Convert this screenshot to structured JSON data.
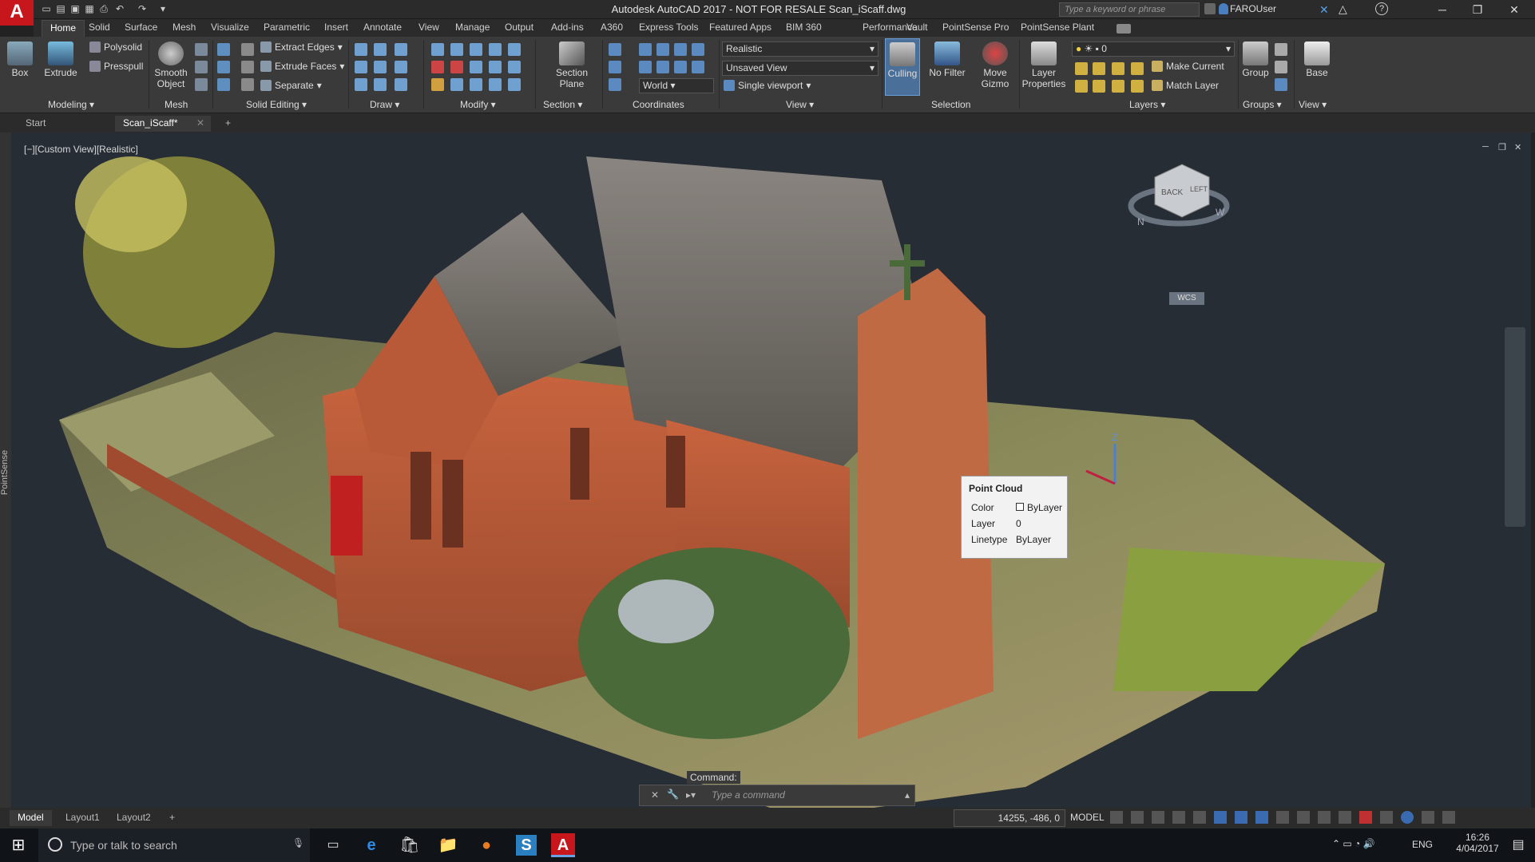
{
  "app": {
    "logo": "A",
    "title": "Autodesk AutoCAD 2017 - NOT FOR RESALE    Scan_iScaff.dwg",
    "search_placeholder": "Type a keyword or phrase",
    "user": "FAROUser"
  },
  "menu_tabs": [
    "Home",
    "Solid",
    "Surface",
    "Mesh",
    "Visualize",
    "Parametric",
    "Insert",
    "Annotate",
    "View",
    "Manage",
    "Output",
    "Add-ins",
    "A360",
    "Express Tools",
    "Featured Apps",
    "BIM 360",
    "Performance",
    "Vault",
    "PointSense Pro",
    "PointSense Plant"
  ],
  "ribbon": {
    "box": "Box",
    "extrude": "Extrude",
    "polysolid": "Polysolid",
    "presspull": "Presspull",
    "smooth_object_1": "Smooth",
    "smooth_object_2": "Object",
    "extract_edges": "Extract Edges",
    "extrude_faces": "Extrude Faces",
    "separate": "Separate",
    "section_plane_1": "Section",
    "section_plane_2": "Plane",
    "visual_style": "Realistic",
    "named_view": "Unsaved View",
    "ucs": "World",
    "viewport_config": "Single viewport",
    "culling": "Culling",
    "no_filter": "No Filter",
    "move_gizmo_1": "Move",
    "move_gizmo_2": "Gizmo",
    "layer_props_1": "Layer",
    "layer_props_2": "Properties",
    "layer_value": "0",
    "make_current": "Make Current",
    "match_layer": "Match Layer",
    "group": "Group",
    "base": "Base",
    "panels": {
      "modeling": "Modeling ▾",
      "mesh": "Mesh",
      "solid_editing": "Solid Editing ▾",
      "draw": "Draw ▾",
      "modify": "Modify ▾",
      "section": "Section ▾",
      "coordinates": "Coordinates",
      "view": "View ▾",
      "selection": "Selection",
      "layers": "Layers ▾",
      "groups": "Groups ▾",
      "view2": "View ▾"
    }
  },
  "doc_tabs": {
    "start": "Start",
    "file": "Scan_iScaff*",
    "add": "+"
  },
  "viewport": {
    "label": "[−][Custom View][Realistic]",
    "side_label": "PointSense",
    "viewcube_back": "BACK",
    "viewcube_left": "LEFT",
    "wcs": "WCS",
    "compass_n": "N",
    "compass_w": "W",
    "axis_z": "Z"
  },
  "tooltip": {
    "title": "Point Cloud",
    "color_label": "Color",
    "color_value": "ByLayer",
    "layer_label": "Layer",
    "layer_value": "0",
    "linetype_label": "Linetype",
    "linetype_value": "ByLayer"
  },
  "command": {
    "label": "Command:",
    "placeholder": "Type a command"
  },
  "layout_tabs": [
    "Model",
    "Layout1",
    "Layout2",
    "+"
  ],
  "status": {
    "coords": "14255, -486, 0",
    "model": "MODEL"
  },
  "taskbar": {
    "search": "Type or talk to search",
    "lang": "ENG",
    "time": "16:26",
    "date": "4/04/2017"
  }
}
